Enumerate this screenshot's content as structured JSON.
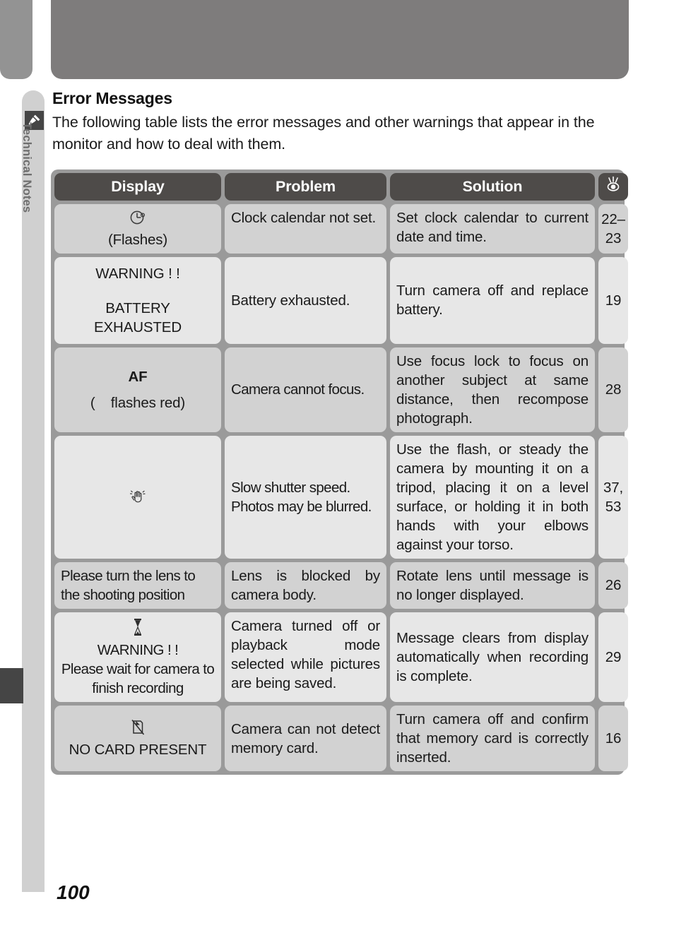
{
  "sidebar": {
    "tab_label": "Technical Notes",
    "icon": "note-pencil-icon"
  },
  "page": {
    "heading": "Error Messages",
    "intro": "The following table lists the error messages and other warnings that appear in the monitor and how to deal with them.",
    "number": "100"
  },
  "table": {
    "headers": {
      "display": "Display",
      "problem": "Problem",
      "solution": "Solution",
      "reference_icon": "eye-reference-icon"
    },
    "rows": [
      {
        "display_icon": "clock-icon",
        "display_line1": "",
        "display_line2": "(Flashes)",
        "problem": "Clock calendar not set.",
        "solution": "Set clock calendar to current date and time.",
        "page_line1": "22–",
        "page_line2": "23"
      },
      {
        "display_icon": "",
        "display_line1": "WARNING ! !",
        "display_line2": "BATTERY",
        "display_line3": "EXHAUSTED",
        "problem": "Battery exhausted.",
        "solution": "Turn camera off and replace battery.",
        "page_line1": "19",
        "page_line2": ""
      },
      {
        "display_icon": "",
        "display_line1": "AF",
        "display_line2": "(    flashes red)",
        "problem": "Camera cannot focus.",
        "solution": "Use focus lock to focus on another subject at same distance, then recompose photograph.",
        "page_line1": "28",
        "page_line2": ""
      },
      {
        "display_icon": "shaking-hand-icon",
        "display_line1": "",
        "display_line2": "",
        "problem": "Slow shutter speed. Photos may be blurred.",
        "solution": "Use the flash, or steady the camera by mounting it on a tripod, placing it on a level surface, or holding it in both hands with your elbows against your torso.",
        "page_line1": "37,",
        "page_line2": "53"
      },
      {
        "display_icon": "",
        "display_line1": "Please turn the lens to the shooting position",
        "display_line2": "",
        "problem": "Lens is blocked by camera body.",
        "solution": "Rotate lens until message is no longer displayed.",
        "page_line1": "26",
        "page_line2": ""
      },
      {
        "display_icon": "hourglass-icon",
        "display_line1": "WARNING ! !",
        "display_line2": "Please wait for camera to finish recording",
        "problem": "Camera turned off or playback mode selected while pictures are being saved.",
        "solution": "Message clears from display automatically when recording is complete.",
        "page_line1": "29",
        "page_line2": ""
      },
      {
        "display_icon": "no-card-icon",
        "display_line1": "",
        "display_line2": "NO CARD PRESENT",
        "problem": "Camera can not detect memory card.",
        "solution": "Turn camera off and confirm that memory card is correctly inserted.",
        "page_line1": "16",
        "page_line2": ""
      }
    ]
  },
  "colors": {
    "header_bg": "#4e4b49",
    "frame": "#9a9a9a",
    "row_light": "#e7e7e7",
    "row_dark": "#d2d2d2",
    "top_bar": "#7e7c7c",
    "side_tab": "#d0d0d0"
  }
}
